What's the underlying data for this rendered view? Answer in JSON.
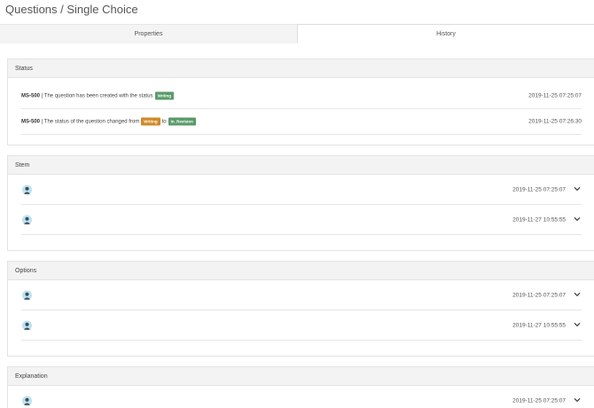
{
  "header": {
    "title": "Questions / Single Choice"
  },
  "tabs": [
    {
      "label": "Properties",
      "active": false
    },
    {
      "label": "History",
      "active": true
    }
  ],
  "status": {
    "title": "Status",
    "rows": [
      {
        "code": "MS-500",
        "text": "| The question has been created with the status",
        "badge1": "Writing",
        "connector": "",
        "badge2": "",
        "time": "2019-11-25 07:25:07"
      },
      {
        "code": "MS-500",
        "text": "| The status of the question changed from",
        "badge1": "Writing",
        "connector": "to",
        "badge2": "In_Revision",
        "time": "2019-11-25 07:26:30"
      }
    ]
  },
  "stem": {
    "title": "Stem",
    "rows": [
      {
        "time": "2019-11-25 07:25:07"
      },
      {
        "time": "2019-11-27 10:55:55"
      }
    ]
  },
  "options": {
    "title": "Options",
    "rows": [
      {
        "time": "2019-11-25 07:25:07"
      },
      {
        "time": "2019-11-27 10:55:55"
      }
    ]
  },
  "explanation": {
    "title": "Explanation",
    "rows": [
      {
        "time": "2019-11-25 07:25:07"
      }
    ]
  },
  "colors": {
    "writing_first": "#5a9a6a",
    "writing_second": "#d08a2a",
    "in_revision": "#5a9a6a"
  }
}
